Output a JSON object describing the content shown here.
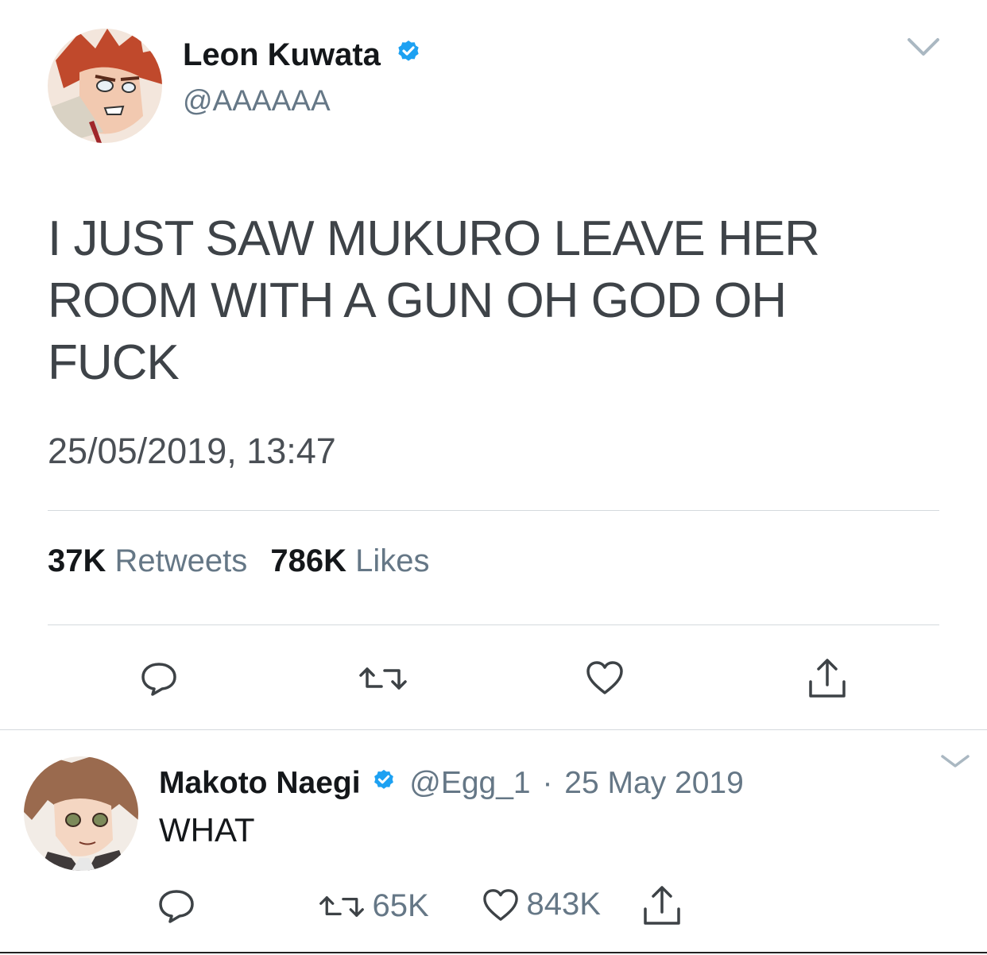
{
  "main_tweet": {
    "author_name": "Leon Kuwata",
    "handle": "@AAAAAA",
    "text": "I JUST SAW MUKURO LEAVE HER ROOM WITH A GUN OH GOD OH FUCK",
    "timestamp": "25/05/2019, 13:47",
    "retweets_count": "37K",
    "retweets_label": "Retweets",
    "likes_count": "786K",
    "likes_label": "Likes",
    "menu_icon": "chevron-down-icon",
    "verified_icon": "verified-badge-icon",
    "actions": [
      "reply-icon",
      "retweet-icon",
      "like-icon",
      "share-icon"
    ]
  },
  "reply_tweet": {
    "author_name": "Makoto Naegi",
    "handle": "@Egg_1",
    "separator": "·",
    "date": "25 May 2019",
    "text": "WHAT",
    "retweets_count": "65K",
    "likes_count": "843K",
    "menu_icon": "chevron-down-icon",
    "verified_icon": "verified-badge-icon",
    "actions": [
      "reply-icon",
      "retweet-icon",
      "like-icon",
      "share-icon"
    ]
  },
  "colors": {
    "verified_blue": "#1da1f2",
    "secondary_text": "#657786",
    "primary_text": "#14171a",
    "divider": "#d4d9dd"
  }
}
